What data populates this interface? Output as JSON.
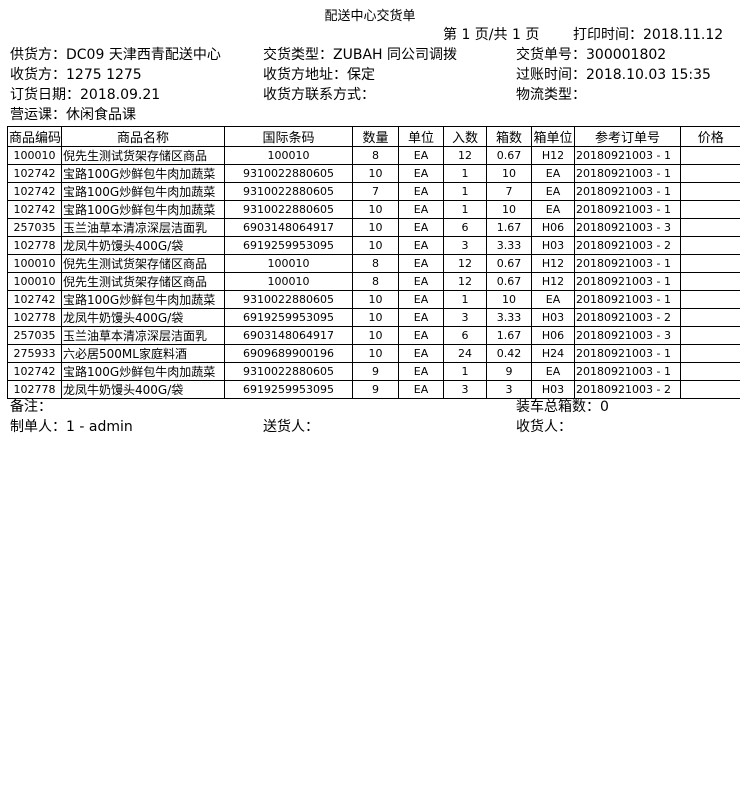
{
  "title": "配送中心交货单",
  "page_info": "第 1 页/共 1 页",
  "print_time": "打印时间：2018.11.12",
  "header": {
    "supplier": "供货方：DC09 天津西青配送中心",
    "delivery_type": "交货类型：ZUBAH 同公司调拨",
    "delivery_no": "交货单号：300001802",
    "receiver": "收货方：1275 1275",
    "receiver_address": "收货方地址：保定",
    "posting_time": "过账时间：2018.10.03 15:35",
    "order_date": "订货日期：2018.09.21",
    "receiver_contact": "收货方联系方式：",
    "logistics_type": "物流类型：",
    "department": "营运课：休闲食品课"
  },
  "table": {
    "columns": [
      "商品编码",
      "商品名称",
      "国际条码",
      "数量",
      "单位",
      "入数",
      "箱数",
      "箱单位",
      "参考订单号",
      "价格"
    ],
    "rows": [
      [
        "100010",
        "倪先生测试货架存储区商品",
        "100010",
        "8",
        "EA",
        "12",
        "0.67",
        "H12",
        "20180921003 - 1",
        ""
      ],
      [
        "102742",
        "宝路100G炒鲜包牛肉加蔬菜",
        "9310022880605",
        "10",
        "EA",
        "1",
        "10",
        "EA",
        "20180921003 - 1",
        ""
      ],
      [
        "102742",
        "宝路100G炒鲜包牛肉加蔬菜",
        "9310022880605",
        "7",
        "EA",
        "1",
        "7",
        "EA",
        "20180921003 - 1",
        ""
      ],
      [
        "102742",
        "宝路100G炒鲜包牛肉加蔬菜",
        "9310022880605",
        "10",
        "EA",
        "1",
        "10",
        "EA",
        "20180921003 - 1",
        ""
      ],
      [
        "257035",
        "玉兰油草本清凉深层洁面乳",
        "6903148064917",
        "10",
        "EA",
        "6",
        "1.67",
        "H06",
        "20180921003 - 3",
        ""
      ],
      [
        "102778",
        "龙凤牛奶馒头400G/袋",
        "6919259953095",
        "10",
        "EA",
        "3",
        "3.33",
        "H03",
        "20180921003 - 2",
        ""
      ],
      [
        "100010",
        "倪先生测试货架存储区商品",
        "100010",
        "8",
        "EA",
        "12",
        "0.67",
        "H12",
        "20180921003 - 1",
        ""
      ],
      [
        "100010",
        "倪先生测试货架存储区商品",
        "100010",
        "8",
        "EA",
        "12",
        "0.67",
        "H12",
        "20180921003 - 1",
        ""
      ],
      [
        "102742",
        "宝路100G炒鲜包牛肉加蔬菜",
        "9310022880605",
        "10",
        "EA",
        "1",
        "10",
        "EA",
        "20180921003 - 1",
        ""
      ],
      [
        "102778",
        "龙凤牛奶馒头400G/袋",
        "6919259953095",
        "10",
        "EA",
        "3",
        "3.33",
        "H03",
        "20180921003 - 2",
        ""
      ],
      [
        "257035",
        "玉兰油草本清凉深层洁面乳",
        "6903148064917",
        "10",
        "EA",
        "6",
        "1.67",
        "H06",
        "20180921003 - 3",
        ""
      ],
      [
        "275933",
        "六必居500ML家庭料酒",
        "6909689900196",
        "10",
        "EA",
        "24",
        "0.42",
        "H24",
        "20180921003 - 1",
        ""
      ],
      [
        "102742",
        "宝路100G炒鲜包牛肉加蔬菜",
        "9310022880605",
        "9",
        "EA",
        "1",
        "9",
        "EA",
        "20180921003 - 1",
        ""
      ],
      [
        "102778",
        "龙凤牛奶馒头400G/袋",
        "6919259953095",
        "9",
        "EA",
        "3",
        "3",
        "H03",
        "20180921003 - 2",
        ""
      ]
    ]
  },
  "footer": {
    "remark": "备注：",
    "total_boxes": "装车总箱数：0",
    "creator": "制单人：1 - admin",
    "deliverer": "送货人：",
    "receiver_sign": "收货人："
  }
}
